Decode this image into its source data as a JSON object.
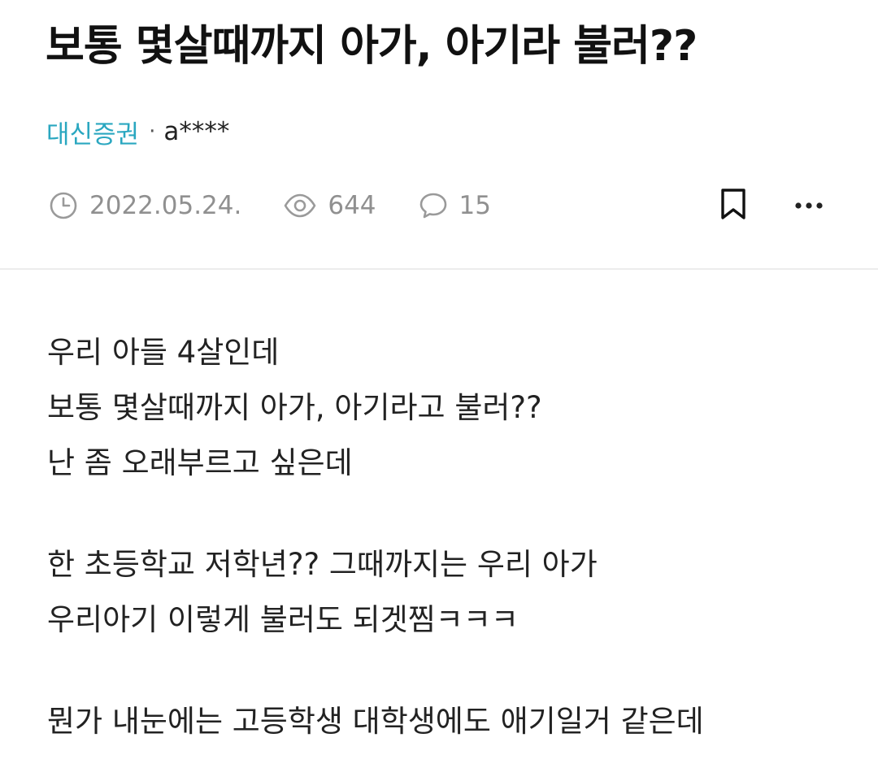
{
  "post": {
    "title": "보통 몇살때까지 아가, 아기라 불러??",
    "company": "대신증권",
    "separator": "·",
    "author": "a****",
    "date": "2022.05.24.",
    "views": "644",
    "comments": "15"
  },
  "icons": {
    "date": "clock-icon",
    "views": "eye-icon",
    "comments": "speech-bubble-icon",
    "bookmark": "bookmark-icon",
    "more": "more-dots-icon"
  },
  "colors": {
    "company": "#2aa7c0",
    "meta_gray": "#909090",
    "title": "#111111",
    "divider": "#ececec"
  },
  "body": {
    "paragraphs": [
      {
        "lines": [
          "우리 아들 4살인데",
          "보통 몇살때까지 아가, 아기라고 불러??",
          "난 좀 오래부르고 싶은데"
        ]
      },
      {
        "lines": [
          "한 초등학교 저학년?? 그때까지는 우리 아가",
          "우리아기 이렇게 불러도 되겟찜ㅋㅋㅋ"
        ]
      },
      {
        "lines": [
          "뭔가 내눈에는 고등학생 대학생에도 애기일거 같은데"
        ]
      }
    ]
  }
}
